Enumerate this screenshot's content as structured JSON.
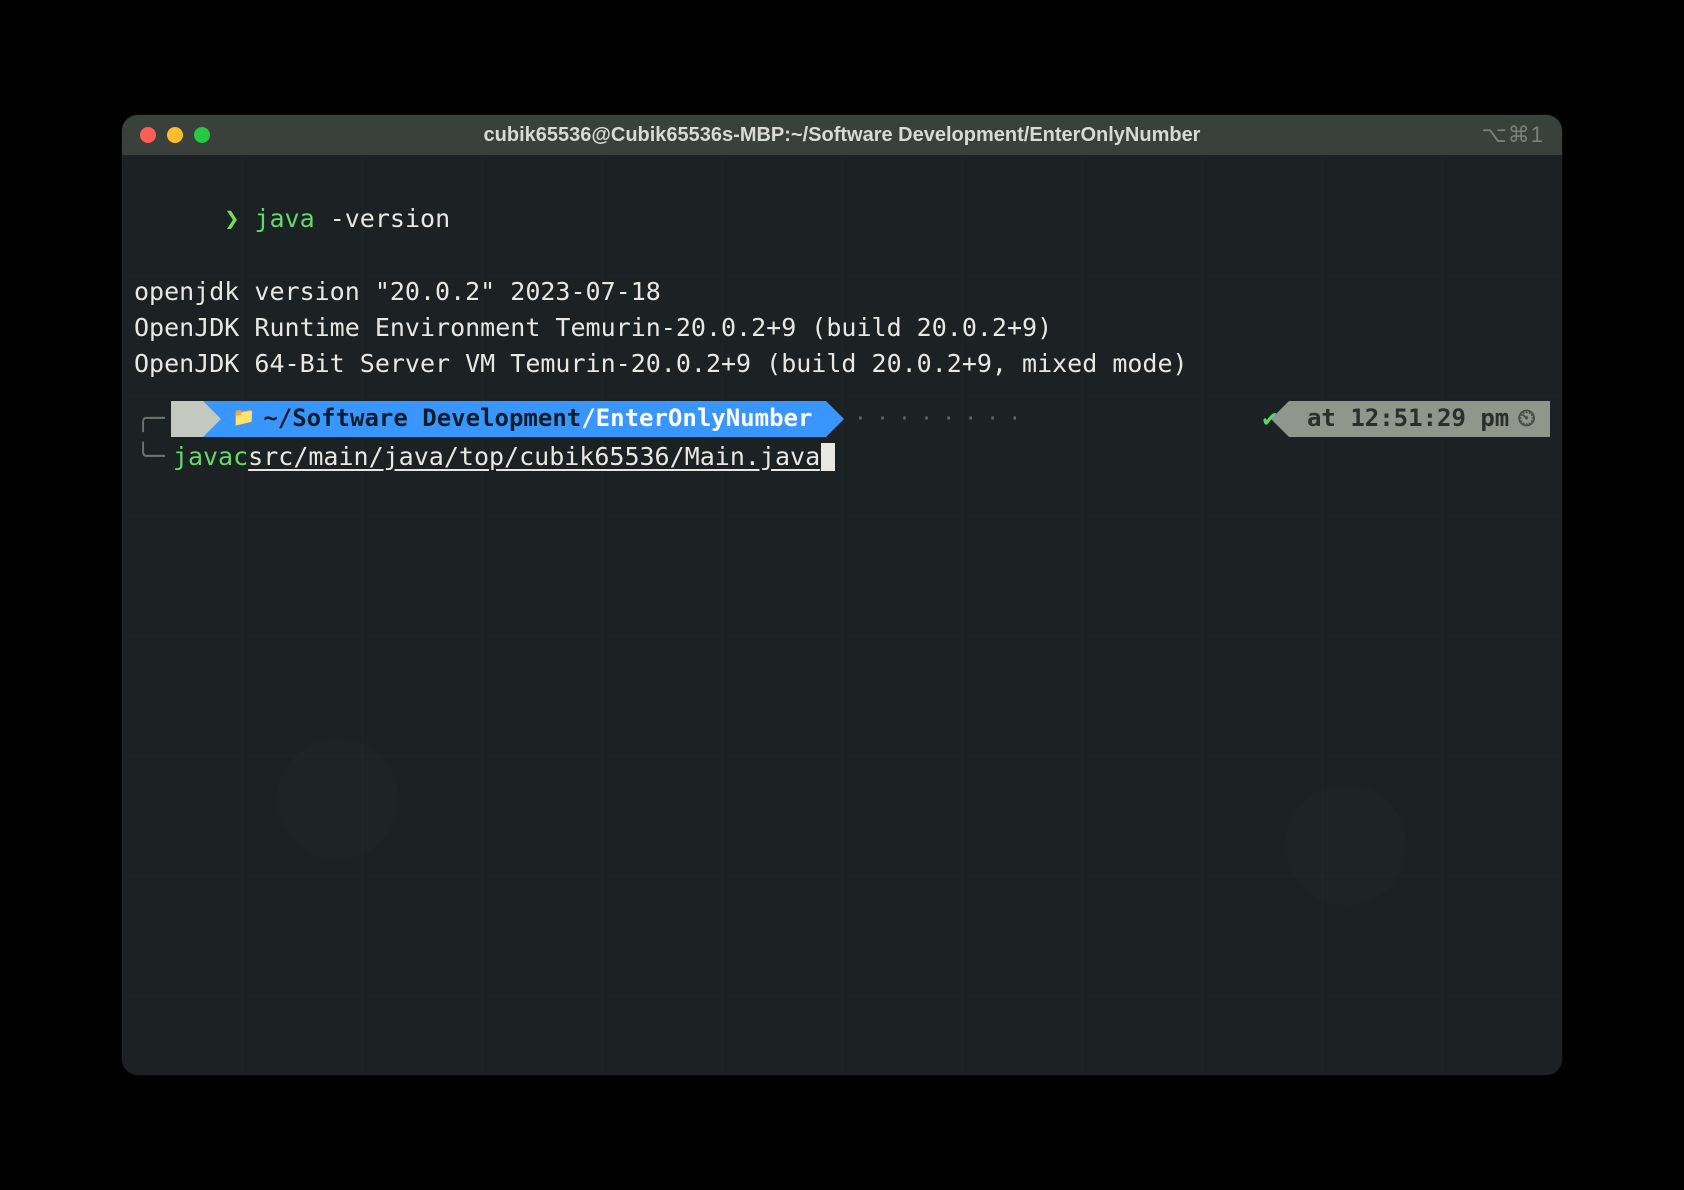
{
  "window": {
    "title": "cubik65536@Cubik65536s-MBP:~/Software Development/EnterOnlyNumber",
    "shortcut": "⌥⌘1"
  },
  "traffic_lights": {
    "red": "#ff5f57",
    "yellow": "#febc2e",
    "green": "#28c840"
  },
  "output": {
    "prompt_caret": "❯",
    "cmd1_name": "java",
    "cmd1_args": " -version",
    "line2": "openjdk version \"20.0.2\" 2023-07-18",
    "line3": "OpenJDK Runtime Environment Temurin-20.0.2+9 (build 20.0.2+9)",
    "line4": "OpenJDK 64-Bit Server VM Temurin-20.0.2+9 (build 20.0.2+9, mixed mode)"
  },
  "powerline": {
    "branch_top": "╭─",
    "apple_icon": "",
    "folder_icon": "📁",
    "path_prefix": "~/Software Development",
    "path_sep": "/",
    "path_leaf": "EnterOnlyNumber",
    "dots": "········",
    "status_icon": "✔",
    "time_label": "at 12:51:29 pm",
    "clock_icon": "⏲"
  },
  "cmd2": {
    "branch_bottom": "╰─",
    "name": "javac",
    "space": " ",
    "filepath": "src/main/java/top/cubik65536/Main.java"
  }
}
